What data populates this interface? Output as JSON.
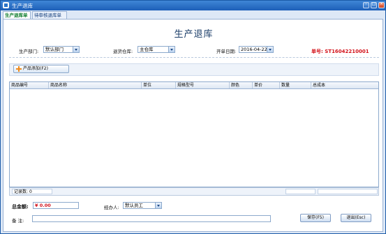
{
  "window": {
    "title": "生产退库"
  },
  "tabs": [
    {
      "label": "生产退库单"
    },
    {
      "label": "待审核退库单"
    }
  ],
  "form": {
    "heading": "生产退库",
    "department_label": "生产部门:",
    "department_value": "默认部门",
    "warehouse_label": "退货仓库:",
    "warehouse_value": "主仓库",
    "date_label": "开单日期:",
    "date_value": "2016-04-22",
    "order_no_label": "单号:",
    "order_no_value": "ST16042210001"
  },
  "toolbar": {
    "add_product_label": "产品添加(F2)"
  },
  "table": {
    "columns": [
      "商品编号",
      "商品名称",
      "单位",
      "规格型号",
      "颜色",
      "单价",
      "数量",
      "总成本"
    ],
    "rows": []
  },
  "status": {
    "record_count_label": "记录数:",
    "record_count_value": "0"
  },
  "footer": {
    "total_label": "总金额:",
    "total_value": "¥ 0.00",
    "handler_label": "经办人:",
    "handler_value": "默认员工",
    "remark_label": "备    注:",
    "remark_value": "",
    "save_label": "保存(F5)",
    "exit_label": "退出(Esc)"
  },
  "colors": {
    "accent": "#1d5fb8",
    "highlight": "#d3121a",
    "active_tab_text": "#0a7a2a"
  },
  "icons": [
    "app-icon",
    "minimize-icon",
    "maximize-icon",
    "close-icon",
    "plus-icon",
    "chevron-down-icon"
  ]
}
